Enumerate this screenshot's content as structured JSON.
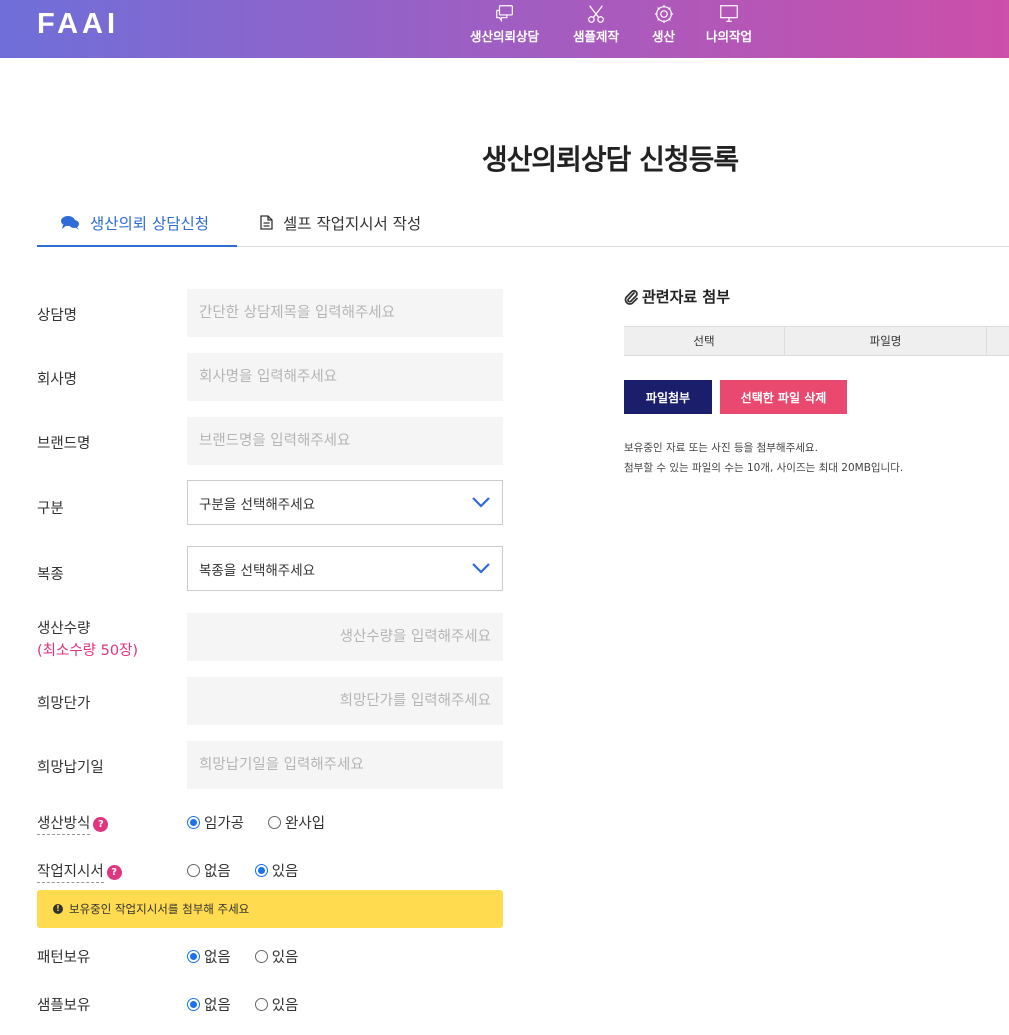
{
  "header": {
    "logo": "FAAI",
    "nav": [
      {
        "label": "생산의뢰상담",
        "icon": "chat-icon"
      },
      {
        "label": "샘플제작",
        "icon": "scissors-icon"
      },
      {
        "label": "생산",
        "icon": "gear-icon"
      },
      {
        "label": "나의작업",
        "icon": "monitor-icon"
      }
    ]
  },
  "page_title": "생산의뢰상담 신청등록",
  "tabs": [
    {
      "label": "생산의뢰 상담신청",
      "active": true,
      "icon": "comments-icon"
    },
    {
      "label": "셀프 작업지시서 작성",
      "active": false,
      "icon": "document-icon"
    }
  ],
  "form": {
    "consult_name": {
      "label": "상담명",
      "placeholder": "간단한 상담제목을 입력해주세요"
    },
    "company": {
      "label": "회사명",
      "placeholder": "회사명을 입력해주세요"
    },
    "brand": {
      "label": "브랜드명",
      "placeholder": "브랜드명을 입력해주세요"
    },
    "category": {
      "label": "구분",
      "value": "구분을 선택해주세요"
    },
    "clothing_type": {
      "label": "복종",
      "value": "복종을 선택해주세요"
    },
    "quantity": {
      "label": "생산수량",
      "sub_label": "(최소수량 50장)",
      "placeholder": "생산수량을 입력해주세요"
    },
    "unit_price": {
      "label": "희망단가",
      "placeholder": "희망단가를 입력해주세요"
    },
    "delivery_date": {
      "label": "희망납기일",
      "placeholder": "희망납기일을 입력해주세요"
    },
    "method": {
      "label": "생산방식",
      "help": "?",
      "options": [
        "임가공",
        "완사입"
      ],
      "selected": "임가공"
    },
    "work_order": {
      "label": "작업지시서",
      "help": "?",
      "options": [
        "없음",
        "있음"
      ],
      "selected": "있음"
    },
    "notice": {
      "icon": "!",
      "text": "보유중인 작업지시서를 첨부해 주세요"
    },
    "pattern": {
      "label": "패턴보유",
      "options": [
        "없음",
        "있음"
      ],
      "selected": "없음"
    },
    "sample": {
      "label": "샘플보유",
      "options": [
        "없음",
        "있음"
      ],
      "selected": "없음"
    }
  },
  "attachments": {
    "title": "관련자료 첨부",
    "columns": [
      "선택",
      "파일명"
    ],
    "attach_button": "파일첨부",
    "delete_button": "선택한 파일 삭제",
    "info_line1": "보유중인 자료 또는 사진 등을 첨부해주세요.",
    "info_line2": "첨부할 수 있는 파일의 수는 10개, 사이즈는 최대 20MB입니다."
  },
  "colors": {
    "accent": "#2e6cd6",
    "pink": "#e0357f",
    "navy": "#1b1f6b",
    "notice": "#ffdb4f"
  }
}
